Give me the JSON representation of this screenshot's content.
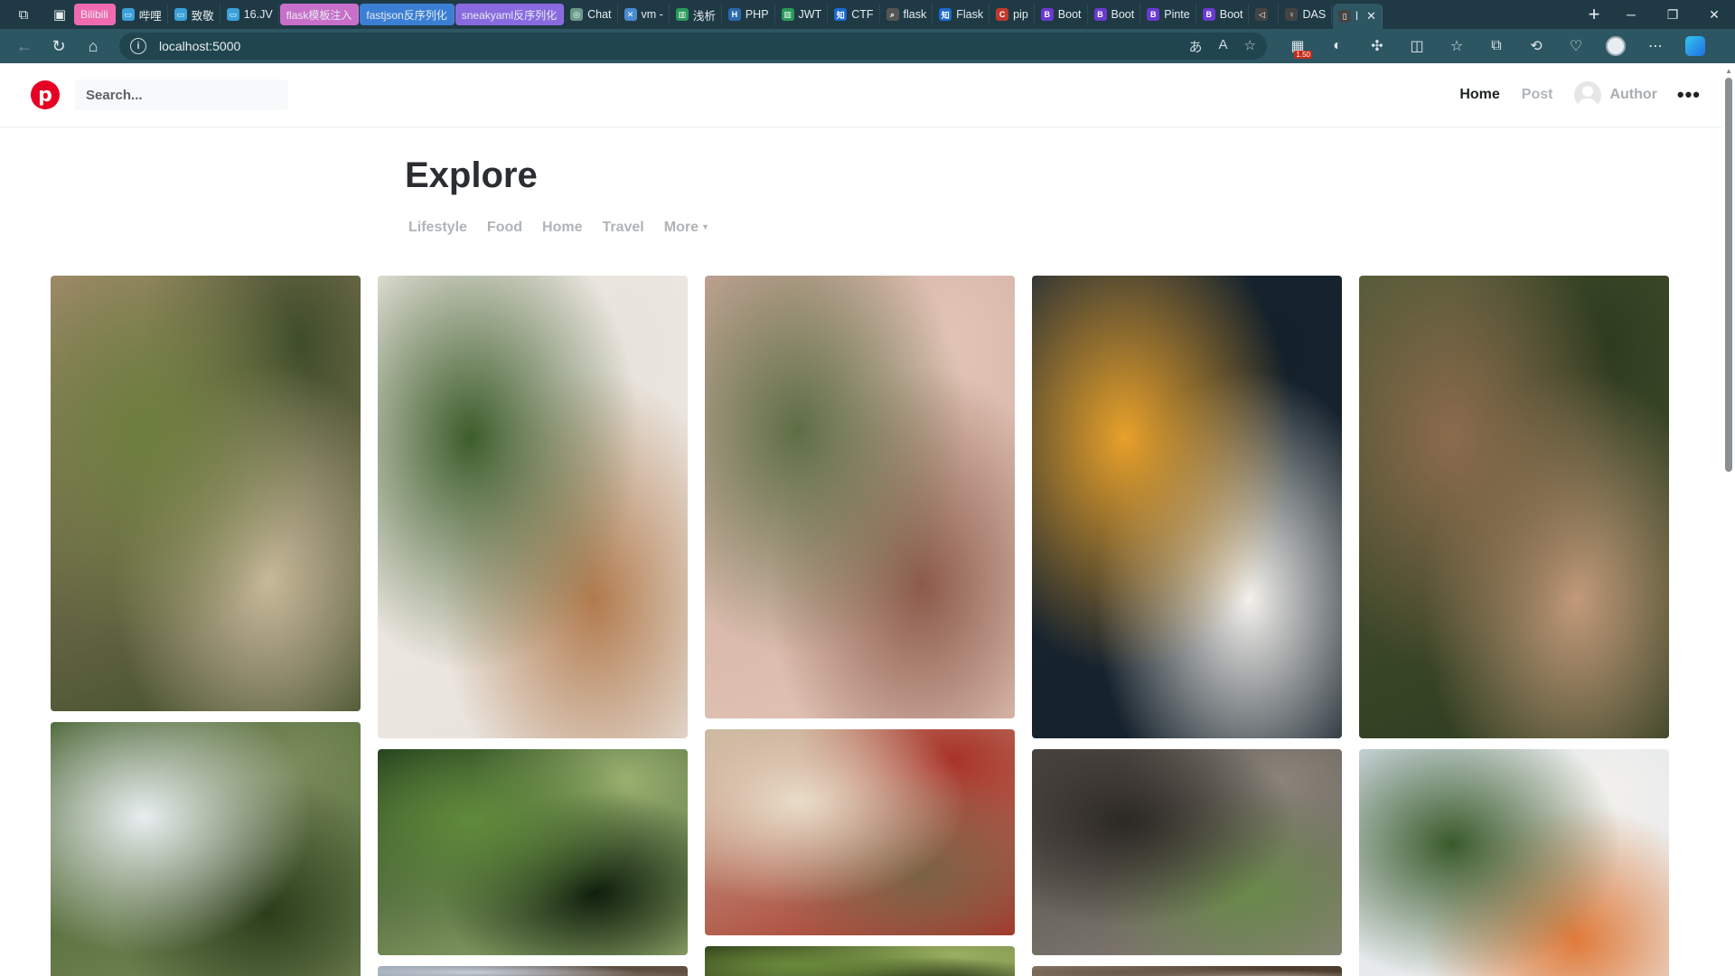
{
  "browser": {
    "tabs": [
      {
        "label": "Bilibili",
        "style": "pill",
        "color": "#f06ab0"
      },
      {
        "label": "哔哩",
        "icon": "tv-icon"
      },
      {
        "label": "致敬",
        "icon": "tv-icon"
      },
      {
        "label": "16.JV",
        "icon": "tv-icon"
      },
      {
        "label": "flask模板注入",
        "style": "pill",
        "color": "#c86fc9"
      },
      {
        "label": "fastjson反序列化",
        "style": "pill",
        "color": "#3b7fd4"
      },
      {
        "label": "sneakyaml反序列化",
        "style": "pill",
        "color": "#8a6ae0"
      },
      {
        "label": "Chat",
        "icon": "chat-icon"
      },
      {
        "label": "vm -",
        "icon": "code-icon"
      },
      {
        "label": "浅析",
        "icon": "bars-icon"
      },
      {
        "label": "PHP",
        "icon": "h-icon"
      },
      {
        "label": "JWT",
        "icon": "bars-icon"
      },
      {
        "label": "CTF",
        "icon": "zhi-icon"
      },
      {
        "label": "flask",
        "icon": "search-icon"
      },
      {
        "label": "Flask",
        "icon": "zhi-icon"
      },
      {
        "label": "pip",
        "icon": "c-icon"
      },
      {
        "label": "Boot",
        "icon": "b-icon"
      },
      {
        "label": "Boot",
        "icon": "b-icon"
      },
      {
        "label": "Pinte",
        "icon": "b-icon"
      },
      {
        "label": "Boot",
        "icon": "b-icon"
      },
      {
        "label": "",
        "icon": "speaker-icon"
      },
      {
        "label": "DAS",
        "icon": "bulb-icon"
      },
      {
        "label": "l",
        "icon": "page-icon",
        "active": true
      }
    ],
    "url": "localhost:5000",
    "ext_badge": "1.50"
  },
  "site": {
    "search_placeholder": "Search...",
    "nav": {
      "home": "Home",
      "post": "Post",
      "author": "Author"
    },
    "more": "•••",
    "logo": "p"
  },
  "explore": {
    "title": "Explore",
    "filters": [
      "Lifestyle",
      "Food",
      "Home",
      "Travel",
      "More"
    ]
  },
  "pins": [
    {
      "col": 0,
      "desc": "welcome-sign-flower-baskets",
      "colors": [
        "#a58c6e",
        "#6d7f3e",
        "#c7b89a",
        "#3f4d2a"
      ]
    },
    {
      "col": 1,
      "desc": "potted-houseplants",
      "colors": [
        "#f1ece6",
        "#3d5d2b",
        "#b17a4d",
        "#e8e3dc"
      ]
    },
    {
      "col": 2,
      "desc": "patio-with-palm-leaves",
      "colors": [
        "#c9a89a",
        "#5d6e45",
        "#8b5a4a",
        "#e2c4b6"
      ]
    },
    {
      "col": 3,
      "desc": "plate-of-peaches",
      "colors": [
        "#1c2a36",
        "#e8a12a",
        "#f3f1ec",
        "#14202a"
      ]
    },
    {
      "col": 4,
      "desc": "cobblestone-garden-path",
      "colors": [
        "#4f5a36",
        "#8c6b4d",
        "#c29a7a",
        "#2e3b1f"
      ]
    },
    {
      "col": 0,
      "desc": "greenhouse-ivy",
      "colors": [
        "#3e5a26",
        "#e8eef0",
        "#2c3d1b",
        "#7a8a5b"
      ]
    },
    {
      "col": 1,
      "desc": "round-garden-window",
      "colors": [
        "#1e3a1a",
        "#5f8a3a",
        "#0f1f0c",
        "#9ab070"
      ]
    },
    {
      "col": 2,
      "desc": "no-parking-sign",
      "colors": [
        "#c9b59a",
        "#e8dcc8",
        "#7a6244",
        "#a83228"
      ]
    },
    {
      "col": 3,
      "desc": "seedlings-tray",
      "colors": [
        "#4a4540",
        "#2c2824",
        "#6a8a4a",
        "#8a847a"
      ]
    },
    {
      "col": 4,
      "desc": "city-street-with-tree",
      "colors": [
        "#d6e2ec",
        "#3a5a2a",
        "#e07a3a",
        "#f2f0ec"
      ]
    },
    {
      "col": 2,
      "desc": "hanging-plant",
      "colors": [
        "#2a3a18",
        "#6a8a3a",
        "#1a2410",
        "#9ab060"
      ]
    },
    {
      "col": 1,
      "desc": "partial-image",
      "colors": [
        "#9aa6b8",
        "#c4ccd6",
        "#7a6a5a",
        "#5a4a3a"
      ]
    },
    {
      "col": 3,
      "desc": "partial-image",
      "colors": [
        "#8a7a6a",
        "#6a5a4a",
        "#aa9a8a",
        "#4a3a2a"
      ]
    }
  ]
}
